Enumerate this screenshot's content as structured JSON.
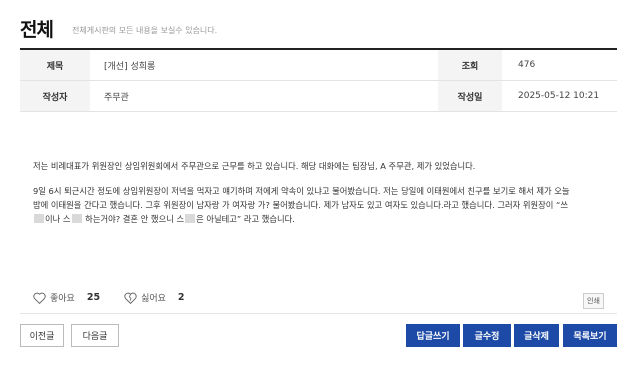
{
  "header": {
    "title": "전체",
    "description": "전체게시판의 모든 내용을 보실수 있습니다."
  },
  "info": {
    "subject_label": "제목",
    "subject_value": "[개선] 성희롱",
    "views_label": "조회",
    "views_value": "476",
    "author_label": "작성자",
    "author_value": "주무관",
    "date_label": "작성일",
    "date_value": "2025-05-12 10:21"
  },
  "body": {
    "para1": "저는 비례대표가 위원장인 상임위원회에서 주무관으로 근무를 하고 있습니다. 해당 대화에는 팀장님, A 주무관, 제가 있었습니다.",
    "para2_line1": "9일 6시 퇴근시간 정도에 상임위원장이 저녁을 먹자고 얘기하며 저에게 약속이 있냐고 물어봤습니다. 저는 당일에 이태원에서 친구를 보기로 해서 제가 오늘",
    "para2_line2": "밤에 이태원을 간다고 했습니다. 그후 위원장이 남자랑 가 여자랑 가? 물어봤습니다. 제가 남자도 있고 여자도 있습니다.라고 했습니다. 그러자 위원장이 “쓰",
    "para2_line3_a": "이나 스",
    "para2_line3_b": " 하는거야? 결혼 안 했으니 스",
    "para2_line3_c": "은 아닐테고” 라고 했습니다."
  },
  "reactions": {
    "like_label": "좋아요",
    "like_count": "25",
    "dislike_label": "싫어요",
    "dislike_count": "2",
    "print_label": "인쇄"
  },
  "buttons": {
    "prev": "이전글",
    "next": "다음글",
    "reply": "답글쓰기",
    "edit": "글수정",
    "delete": "글삭제",
    "list": "목록보기"
  },
  "colors": {
    "primary": "#1c4aa6",
    "label_bg": "#f4f4f4"
  }
}
